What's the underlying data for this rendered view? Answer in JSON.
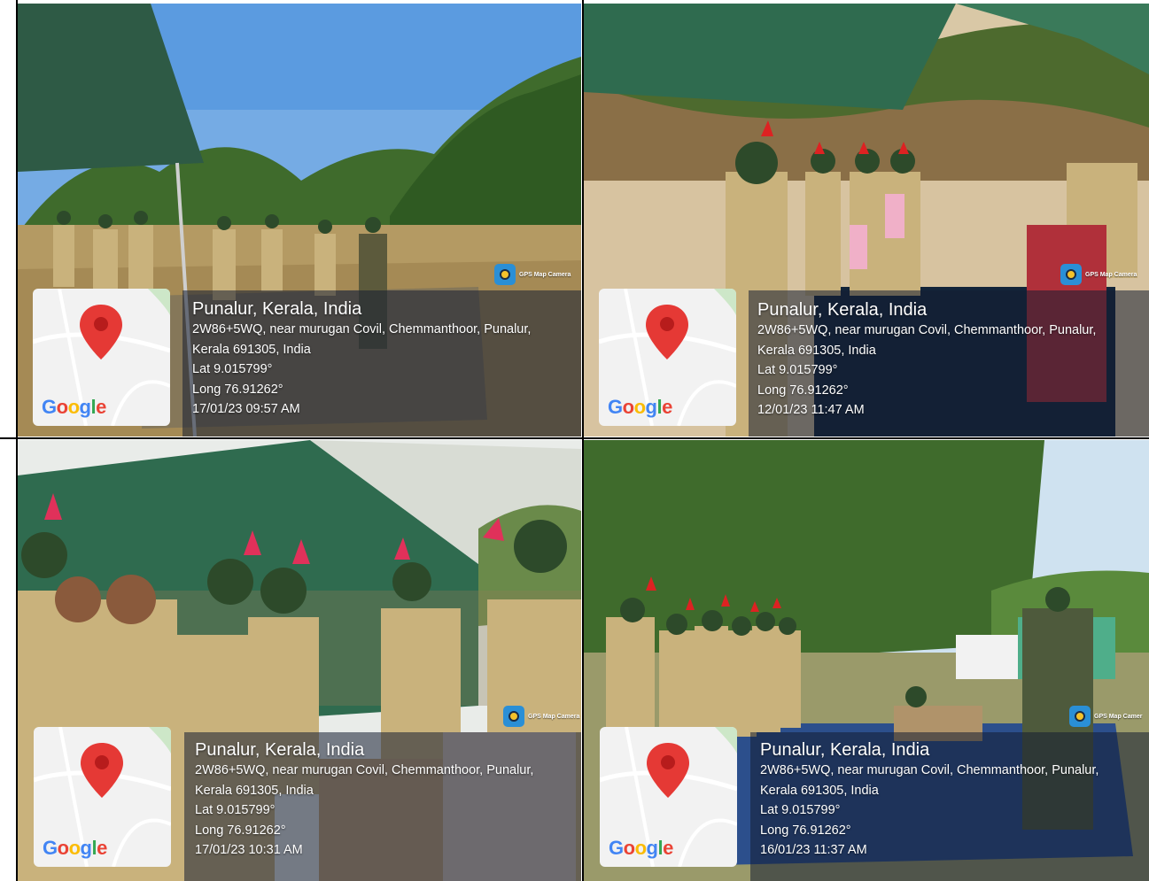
{
  "photos": [
    {
      "place": "Punalur, Kerala, India",
      "address_line1": "2W86+5WQ, near murugan Covil, Chemmanthoor, Punalur,",
      "address_line2": "Kerala 691305, India",
      "lat": "Lat 9.015799°",
      "long": "Long 76.91262°",
      "datetime": "17/01/23 09:57 AM",
      "camera_label": "GPS Map Camera",
      "map_logo": "Google"
    },
    {
      "place": "Punalur, Kerala, India",
      "address_line1": "2W86+5WQ, near murugan Covil, Chemmanthoor, Punalur,",
      "address_line2": "Kerala 691305, India",
      "lat": "Lat 9.015799°",
      "long": "Long 76.91262°",
      "datetime": "12/01/23 11:47 AM",
      "camera_label": "GPS Map Camera",
      "map_logo": "Google"
    },
    {
      "place": "Punalur, Kerala, India",
      "address_line1": "2W86+5WQ, near murugan Covil, Chemmanthoor, Punalur,",
      "address_line2": "Kerala 691305, India",
      "lat": "Lat 9.015799°",
      "long": "Long 76.91262°",
      "datetime": "17/01/23 10:31 AM",
      "camera_label": "GPS Map Camera",
      "map_logo": "Google"
    },
    {
      "place": "Punalur, Kerala, India",
      "address_line1": "2W86+5WQ, near murugan Covil, Chemmanthoor, Punalur,",
      "address_line2": "Kerala 691305, India",
      "lat": "Lat 9.015799°",
      "long": "Long 76.91262°",
      "datetime": "16/01/23 11:37 AM",
      "camera_label": "GPS Map Camer",
      "map_logo": "Google"
    }
  ],
  "icons": {
    "map_pin": "map-pin-icon",
    "camera": "gps-map-camera-icon"
  },
  "colors": {
    "pin_red": "#e53935",
    "stamp_text": "#ffffff",
    "khaki": "#c9b27c",
    "tarp_green": "#2f6b4f"
  }
}
